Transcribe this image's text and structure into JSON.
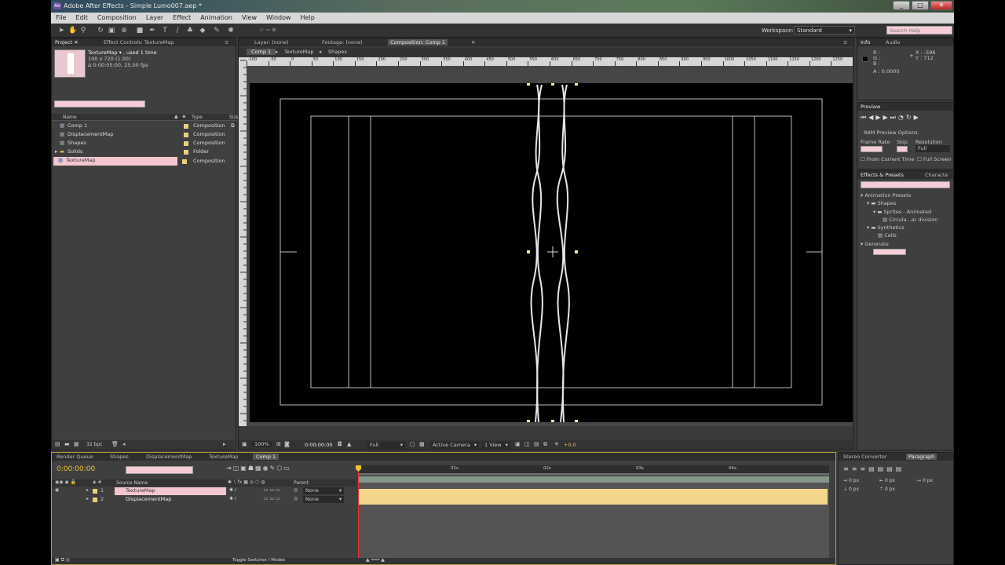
{
  "window": {
    "title": "Adobe After Effects - Simple Lumo007.aep *",
    "controls": [
      "_",
      "□",
      "✕"
    ]
  },
  "menu": [
    "File",
    "Edit",
    "Composition",
    "Layer",
    "Effect",
    "Animation",
    "View",
    "Window",
    "Help"
  ],
  "workspace": {
    "label": "Workspace:",
    "value": "Standard",
    "search_placeholder": "Search Help"
  },
  "project": {
    "tabs": [
      "Project ✕",
      "Effect Controls: TextureMap"
    ],
    "preview_name": "TextureMap ▾ , used 1 time",
    "preview_size": "100 x 720 (1.00)",
    "preview_duration": "Δ 0:00:05:00, 25.00 fps",
    "columns": {
      "name": "Name",
      "type": "Type",
      "size": "Size"
    },
    "items": [
      {
        "name": "Comp 1",
        "type": "Composition"
      },
      {
        "name": "DisplacementMap",
        "type": "Composition"
      },
      {
        "name": "Shapes",
        "type": "Composition"
      },
      {
        "name": "Solids",
        "type": "Folder"
      },
      {
        "name": "TextureMap",
        "type": "Composition"
      }
    ],
    "bpc": "32 bpc"
  },
  "viewer": {
    "tabs": [
      "Layer: (none)",
      "Footage: (none)",
      "Composition: Comp 1"
    ],
    "flow": [
      "Comp 1",
      "TextureMap",
      "Shapes"
    ],
    "ruler_labels": [
      "-100",
      "-50",
      "0",
      "50",
      "100",
      "150",
      "200",
      "250",
      "300",
      "350",
      "400",
      "450",
      "500",
      "550",
      "600",
      "650",
      "700",
      "750",
      "800",
      "850",
      "900",
      "950",
      "1000",
      "1050",
      "1100",
      "1150",
      "1200",
      "1250"
    ],
    "zoom": "100%",
    "timecode": "0:00:00:00",
    "resolution": "Full",
    "camera": "Active Camera",
    "views": "1 View",
    "exposure": "+0.0"
  },
  "info": {
    "tabs": [
      "Info",
      "Audio"
    ],
    "r": "R :",
    "g": "G :",
    "b": "B :",
    "a": "A : 0.0000",
    "x": "X : -596",
    "y": "Y : 712"
  },
  "preview": {
    "tab": "Preview",
    "ram_options": "RAM Preview Options",
    "frame_rate_label": "Frame Rate",
    "skip_label": "Skip",
    "resolution_label": "Resolution",
    "resolution_value": "Full",
    "from_current": "From Current Time",
    "full_screen": "Full Screen"
  },
  "effects": {
    "tabs": [
      "Effects & Presets",
      "Characte"
    ],
    "tree": [
      {
        "label": "Animation Presets",
        "level": 0
      },
      {
        "label": "Shapes",
        "level": 1
      },
      {
        "label": "Sprites - Animated",
        "level": 2
      },
      {
        "label": "Circula...ar division",
        "level": 3
      },
      {
        "label": "Synthetics",
        "level": 1
      },
      {
        "label": "Cells",
        "level": 2
      },
      {
        "label": "Generate",
        "level": 0
      }
    ]
  },
  "timeline": {
    "tabs": [
      "Render Queue",
      "Shapes",
      "DisplacementMap",
      "TextureMap",
      "Comp 1"
    ],
    "timecode": "0:00:00:00",
    "columns": {
      "source": "Source Name",
      "parent": "Parent"
    },
    "layers": [
      {
        "num": "1",
        "name": "TextureMap",
        "parent": "None"
      },
      {
        "num": "2",
        "name": "DisplacementMap",
        "parent": "None"
      }
    ],
    "time_marks": [
      "00s",
      "01s",
      "02s",
      "03s",
      "04s",
      "05s"
    ],
    "toggle": "Toggle Switches / Modes"
  },
  "right_bottom": {
    "tabs": [
      "Stereo Converter",
      "Paragraph"
    ],
    "values": [
      "0 px",
      "0 px",
      "0 px",
      "0 px",
      "0 px"
    ]
  }
}
